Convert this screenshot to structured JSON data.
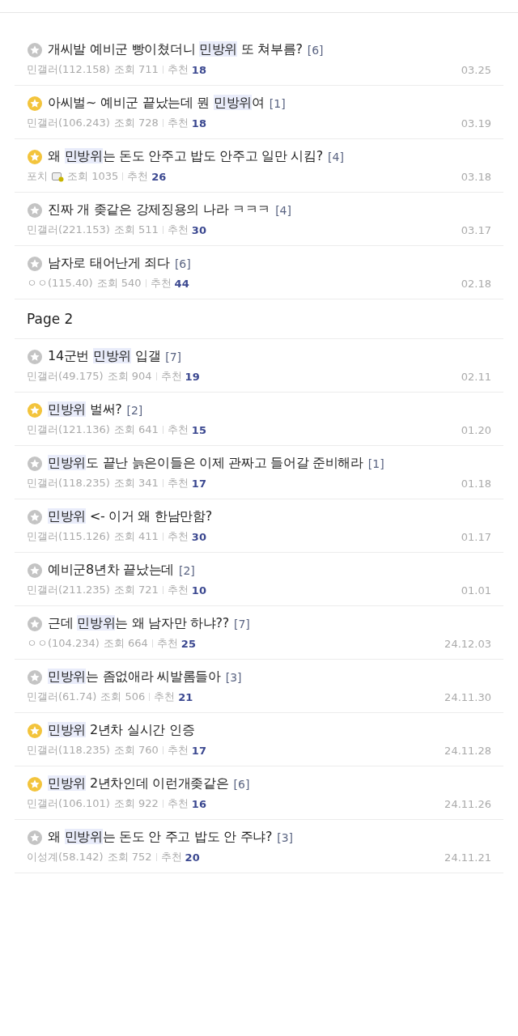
{
  "sections": [
    {
      "posts": [
        {
          "featured": false,
          "title": [
            {
              "text": "개씨발 예비군 빵이쳤더니 ",
              "highlight": false
            },
            {
              "text": "민방위",
              "highlight": true
            },
            {
              "text": " 또 쳐부름?",
              "highlight": false
            }
          ],
          "comments": "[6]",
          "author": "민갤러(112.158)",
          "author_badge": false,
          "views": "조회 711",
          "recommend_label": "추천",
          "recommend": "18",
          "date": "03.25"
        },
        {
          "featured": true,
          "title": [
            {
              "text": "아씨벌~ 예비군 끝났는데 뭔 ",
              "highlight": false
            },
            {
              "text": "민방위",
              "highlight": true
            },
            {
              "text": "여",
              "highlight": false
            }
          ],
          "comments": "[1]",
          "author": "민갤러(106.243)",
          "author_badge": false,
          "views": "조회 728",
          "recommend_label": "추천",
          "recommend": "18",
          "date": "03.19"
        },
        {
          "featured": true,
          "title": [
            {
              "text": "왜 ",
              "highlight": false
            },
            {
              "text": "민방위",
              "highlight": true
            },
            {
              "text": "는 돈도 안주고 밥도 안주고 일만 시킴?",
              "highlight": false
            }
          ],
          "comments": "[4]",
          "author": "포치",
          "author_badge": true,
          "views": "조회 1035",
          "recommend_label": "추천",
          "recommend": "26",
          "date": "03.18"
        },
        {
          "featured": false,
          "title": [
            {
              "text": "진짜 개 좆같은 강제징용의 나라 ㅋㅋㅋ",
              "highlight": false
            }
          ],
          "comments": "[4]",
          "author": "민갤러(221.153)",
          "author_badge": false,
          "views": "조회 511",
          "recommend_label": "추천",
          "recommend": "30",
          "date": "03.17"
        },
        {
          "featured": false,
          "title": [
            {
              "text": "남자로 태어난게 죄다",
              "highlight": false
            }
          ],
          "comments": "[6]",
          "author": "ㅇㅇ(115.40)",
          "author_badge": false,
          "views": "조회 540",
          "recommend_label": "추천",
          "recommend": "44",
          "date": "02.18"
        }
      ]
    },
    {
      "heading": "Page 2",
      "posts": [
        {
          "featured": false,
          "title": [
            {
              "text": "14군번 ",
              "highlight": false
            },
            {
              "text": "민방위",
              "highlight": true
            },
            {
              "text": " 입갤",
              "highlight": false
            }
          ],
          "comments": "[7]",
          "author": "민갤러(49.175)",
          "author_badge": false,
          "views": "조회 904",
          "recommend_label": "추천",
          "recommend": "19",
          "date": "02.11"
        },
        {
          "featured": true,
          "title": [
            {
              "text": "민방위",
              "highlight": true
            },
            {
              "text": " 벌써?",
              "highlight": false
            }
          ],
          "comments": "[2]",
          "author": "민갤러(121.136)",
          "author_badge": false,
          "views": "조회 641",
          "recommend_label": "추천",
          "recommend": "15",
          "date": "01.20"
        },
        {
          "featured": false,
          "title": [
            {
              "text": "민방위",
              "highlight": true
            },
            {
              "text": "도 끝난 늙은이들은 이제 관짜고 들어갈 준비해라",
              "highlight": false
            }
          ],
          "comments": "[1]",
          "author": "민갤러(118.235)",
          "author_badge": false,
          "views": "조회 341",
          "recommend_label": "추천",
          "recommend": "17",
          "date": "01.18"
        },
        {
          "featured": false,
          "title": [
            {
              "text": "민방위",
              "highlight": true
            },
            {
              "text": " <- 이거 왜 한남만함?",
              "highlight": false
            }
          ],
          "author": "민갤러(115.126)",
          "author_badge": false,
          "views": "조회 411",
          "recommend_label": "추천",
          "recommend": "30",
          "date": "01.17"
        },
        {
          "featured": false,
          "title": [
            {
              "text": "예비군8년차 끝났는데",
              "highlight": false
            }
          ],
          "comments": "[2]",
          "author": "민갤러(211.235)",
          "author_badge": false,
          "views": "조회 721",
          "recommend_label": "추천",
          "recommend": "10",
          "date": "01.01"
        },
        {
          "featured": false,
          "title": [
            {
              "text": "근데 ",
              "highlight": false
            },
            {
              "text": "민방위",
              "highlight": true
            },
            {
              "text": "는 왜 남자만 하냐??",
              "highlight": false
            }
          ],
          "comments": "[7]",
          "author": "ㅇㅇ(104.234)",
          "author_badge": false,
          "views": "조회 664",
          "recommend_label": "추천",
          "recommend": "25",
          "date": "24.12.03"
        },
        {
          "featured": false,
          "title": [
            {
              "text": "민방위",
              "highlight": true
            },
            {
              "text": "는 좀없애라 씨발롬들아",
              "highlight": false
            }
          ],
          "comments": "[3]",
          "author": "민갤러(61.74)",
          "author_badge": false,
          "views": "조회 506",
          "recommend_label": "추천",
          "recommend": "21",
          "date": "24.11.30"
        },
        {
          "featured": true,
          "title": [
            {
              "text": "민방위",
              "highlight": true
            },
            {
              "text": " 2년차 실시간 인증",
              "highlight": false
            }
          ],
          "author": "민갤러(118.235)",
          "author_badge": false,
          "views": "조회 760",
          "recommend_label": "추천",
          "recommend": "17",
          "date": "24.11.28"
        },
        {
          "featured": true,
          "title": [
            {
              "text": "민방위",
              "highlight": true
            },
            {
              "text": " 2년차인데 이런개좆같은",
              "highlight": false
            }
          ],
          "comments": "[6]",
          "author": "민갤러(106.101)",
          "author_badge": false,
          "views": "조회 922",
          "recommend_label": "추천",
          "recommend": "16",
          "date": "24.11.26"
        },
        {
          "featured": false,
          "title": [
            {
              "text": "왜 ",
              "highlight": false
            },
            {
              "text": "민방위",
              "highlight": true
            },
            {
              "text": "는 돈도 안 주고 밥도 안 주냐?",
              "highlight": false
            }
          ],
          "comments": "[3]",
          "author": "이성계(58.142)",
          "author_badge": false,
          "views": "조회 752",
          "recommend_label": "추천",
          "recommend": "20",
          "date": "24.11.21"
        }
      ]
    }
  ]
}
